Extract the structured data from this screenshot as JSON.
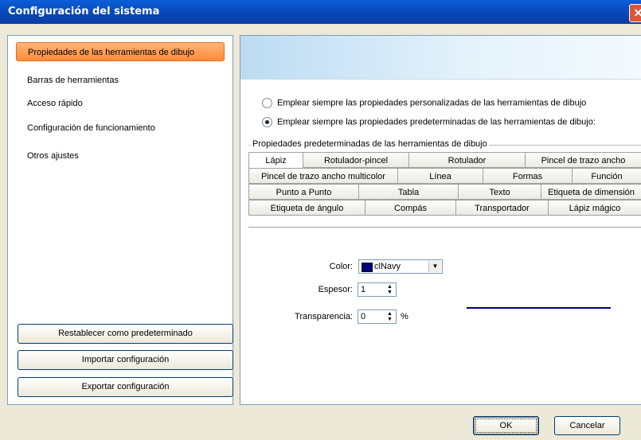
{
  "window": {
    "title": "Configuración del sistema",
    "close_symbol": "✕"
  },
  "sidebar": {
    "items": [
      {
        "label": "Propiedades de las herramientas de dibujo",
        "selected": true
      },
      {
        "label": "Barras de herramientas"
      },
      {
        "label": "Acceso rápido"
      },
      {
        "label": "Configuración de funcionamiento"
      },
      {
        "label": "Otros ajustes"
      }
    ],
    "buttons": {
      "reset": "Restablecer como predeterminado",
      "import": "Importar configuración",
      "export": "Exportar configuración"
    }
  },
  "options": {
    "custom": "Emplear siempre las propiedades personalizadas de las herramientas de dibujo",
    "default": "Emplear siempre las propiedades predeterminadas de las herramientas de dibujo:"
  },
  "group_label": "Propiedades predeterminadas de las herramientas de dibujo",
  "tabs": {
    "row1": [
      "Lápiz",
      "Rotulador-pincel",
      "Rotulador",
      "Pincel de trazo ancho"
    ],
    "row2": [
      "Pincel de trazo ancho multicolor",
      "Línea",
      "Formas",
      "Función"
    ],
    "row3": [
      "Punto a Punto",
      "Tabla",
      "Texto",
      "Etiqueta de dimensión"
    ],
    "row4": [
      "Etiqueta de ángulo",
      "Compás",
      "Transportador",
      "Lápiz mágico"
    ]
  },
  "fields": {
    "color_label": "Color:",
    "color_value": "clNavy",
    "thickness_label": "Espesor:",
    "thickness_value": "1",
    "transparency_label": "Transparencia:",
    "transparency_value": "0",
    "transparency_unit": "%"
  },
  "dialog": {
    "ok": "OK",
    "cancel": "Cancelar"
  },
  "colors": {
    "preview_line": "#000080",
    "selected_item": "#ff8c3a",
    "titlebar": "#0845b5"
  }
}
